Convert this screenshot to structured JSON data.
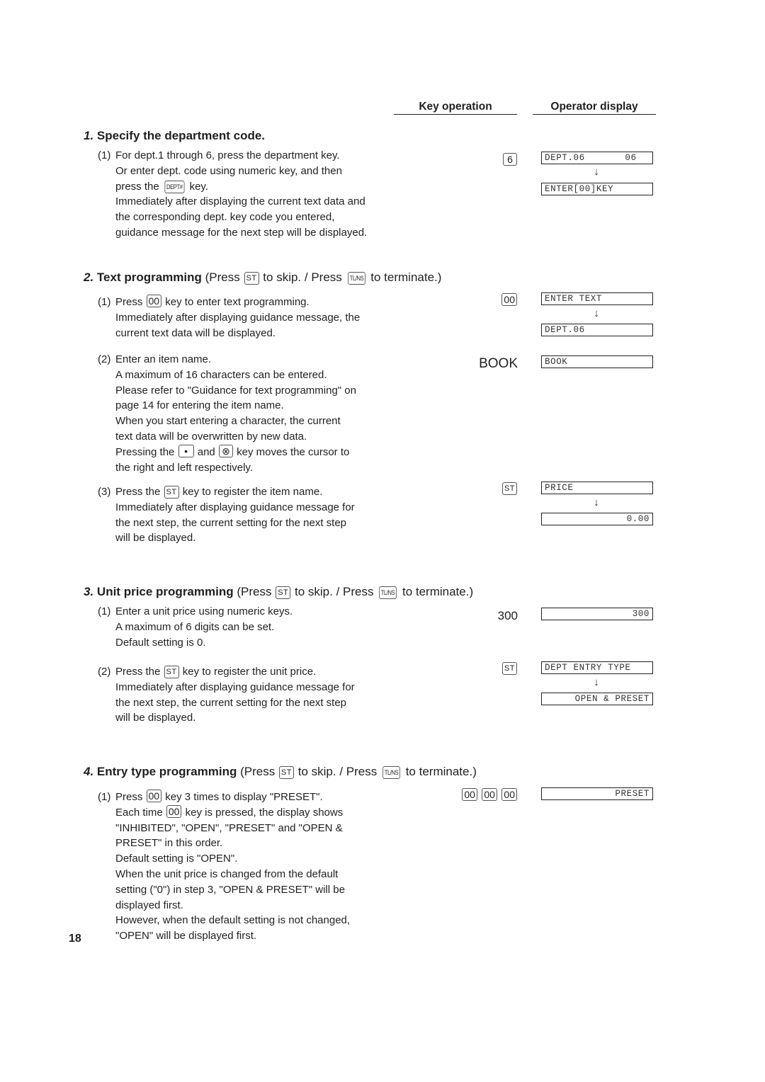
{
  "headers": {
    "key_operation": "Key operation",
    "operator_display": "Operator display"
  },
  "page_number": "18",
  "sections": [
    {
      "number": "1.",
      "title": "Specify the department code.",
      "steps": [
        {
          "label": "(1)",
          "lines": [
            "For dept.1 through 6, press the department key.",
            "Or enter dept. code using numeric key, and then",
            "press the [DEPT#] key.",
            "Immediately after displaying the current text data and",
            "the corresponding dept. key code you entered,",
            "guidance message for the next step will be displayed."
          ],
          "key_op": [
            "6"
          ],
          "display": [
            "DEPT.06       06",
            "ENTER[00]KEY"
          ]
        }
      ]
    },
    {
      "number": "2.",
      "title": "Text programming",
      "suffix_parts": [
        "(Press",
        "ST",
        "to skip. / Press",
        "TL/NS",
        "to terminate.)"
      ],
      "steps": [
        {
          "label": "(1)",
          "lines": [
            "Press [00] key to enter text programming.",
            "Immediately after displaying guidance message, the",
            "current text data will be displayed."
          ],
          "key_op": [
            "00"
          ],
          "display": [
            "ENTER TEXT",
            "DEPT.06"
          ]
        },
        {
          "label": "(2)",
          "lines": [
            "Enter an item name.",
            "A maximum of 16 characters can be entered.",
            "Please refer to \"Guidance for text programming\" on",
            "page 14 for entering the item name.",
            "When you start entering a character, the current",
            "text data will be overwritten by new data.",
            "Pressing the [•] and [⊗] key moves the cursor to",
            "the right and left respectively."
          ],
          "key_op": [
            "BOOK"
          ],
          "display": [
            "BOOK"
          ]
        },
        {
          "label": "(3)",
          "lines": [
            "Press the [ST] key to register the item name.",
            "Immediately after displaying guidance message for",
            "the next step, the current setting for the next step",
            "will be displayed."
          ],
          "key_op": [
            "ST"
          ],
          "display": [
            "PRICE",
            "0.00"
          ]
        }
      ]
    },
    {
      "number": "3.",
      "title": "Unit price programming",
      "suffix_parts": [
        "(Press",
        "ST",
        "to skip. / Press",
        "TL/NS",
        "to terminate.)"
      ],
      "steps": [
        {
          "label": "(1)",
          "lines": [
            "Enter a unit price using numeric keys.",
            "A maximum of 6 digits can be set.",
            "Default setting is 0."
          ],
          "key_op": [
            "300"
          ],
          "display": [
            "300"
          ]
        },
        {
          "label": "(2)",
          "lines": [
            "Press the [ST] key to register the unit price.",
            "Immediately after displaying guidance message for",
            "the next step, the current setting for the next step",
            "will be displayed."
          ],
          "key_op": [
            "ST"
          ],
          "display": [
            "DEPT ENTRY TYPE",
            "OPEN & PRESET"
          ]
        }
      ]
    },
    {
      "number": "4.",
      "title": "Entry type programming",
      "suffix_parts": [
        "(Press",
        "ST",
        "to skip. / Press",
        "TL/NS",
        "to terminate.)"
      ],
      "steps": [
        {
          "label": "(1)",
          "lines": [
            "Press [00] key 3 times to display \"PRESET\".",
            "Each time [00] key is pressed, the display shows",
            "\"INHIBITED\", \"OPEN\", \"PRESET\" and \"OPEN &",
            "PRESET\" in this order.",
            "Default setting is \"OPEN\".",
            "When the unit price is changed from the default",
            "setting (\"0\") in step 3, \"OPEN & PRESET\" will be",
            "displayed first.",
            "However, when the default setting is not changed,",
            "\"OPEN\" will be displayed first."
          ],
          "key_op": [
            "00",
            "00",
            "00"
          ],
          "display": [
            "PRESET"
          ]
        }
      ]
    }
  ],
  "arrow_glyph": "↓",
  "key_labels": {
    "dept": "DEPT#",
    "st": "ST",
    "tlns": "TL/NS",
    "zero_zero": "00",
    "dot": "•",
    "cross": "⊗"
  },
  "inline_text": {
    "s1_l3_a": "press the",
    "s1_l3_b": "key.",
    "s2_1_l1_a": "Press",
    "s2_1_l1_b": "key to enter text programming.",
    "s2_2_l7_a": "Pressing the",
    "s2_2_l7_b": "and",
    "s2_2_l7_c": "key moves the cursor to",
    "s2_3_l1_a": "Press the",
    "s2_3_l1_b": "key to register the item name.",
    "s3_2_l1_a": "Press the",
    "s3_2_l1_b": "key to register the unit price.",
    "s4_1_l1_a": "Press",
    "s4_1_l1_b": "key 3 times to display \"PRESET\".",
    "s4_1_l2_a": "Each time",
    "s4_1_l2_b": "key is pressed, the display shows"
  }
}
